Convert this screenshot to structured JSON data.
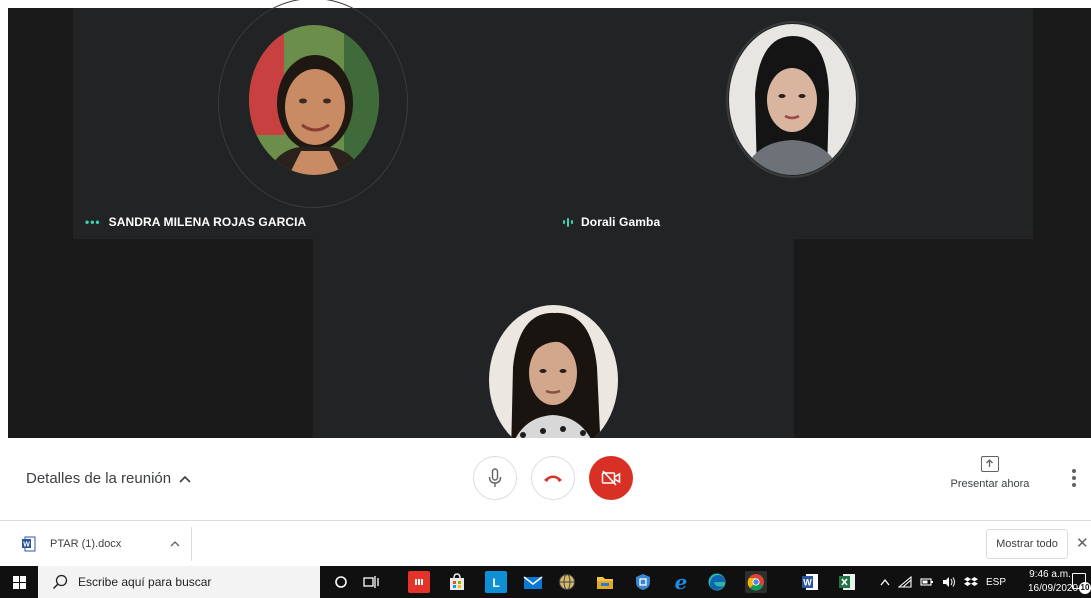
{
  "participants": [
    {
      "name": "SANDRA MILENA ROJAS GARCIA",
      "indicator": "•••"
    },
    {
      "name": "Dorali Gamba",
      "indicator": "audio-bars"
    },
    {
      "name": "",
      "indicator": ""
    }
  ],
  "controls": {
    "meeting_details": "Detalles de la reunión",
    "present_now": "Presentar ahora",
    "mic_icon": "microphone-icon",
    "hangup_icon": "phone-hangup-icon",
    "camera_icon": "camera-off-icon",
    "accent_red": "#d93025"
  },
  "downloads": {
    "file_name": "PTAR (1).docx",
    "show_all": "Mostrar todo",
    "close": "✕"
  },
  "taskbar": {
    "search_placeholder": "Escribe aquí para buscar",
    "language": "ESP",
    "time": "9:46 a.m.",
    "date": "16/09/2020",
    "notifications": "10",
    "icons": [
      "cortana-icon",
      "task-view-icon",
      "app-red-icon",
      "store-icon",
      "lync-icon",
      "mail-icon",
      "globe-icon",
      "file-explorer-icon",
      "shield-icon",
      "edge-legacy-icon",
      "edge-icon",
      "chrome-icon",
      "word-icon",
      "excel-icon"
    ]
  },
  "colors": {
    "stage_bg": "#222325",
    "speaking_indicator": "#3fd0b4",
    "taskbar_bg": "#101010"
  }
}
